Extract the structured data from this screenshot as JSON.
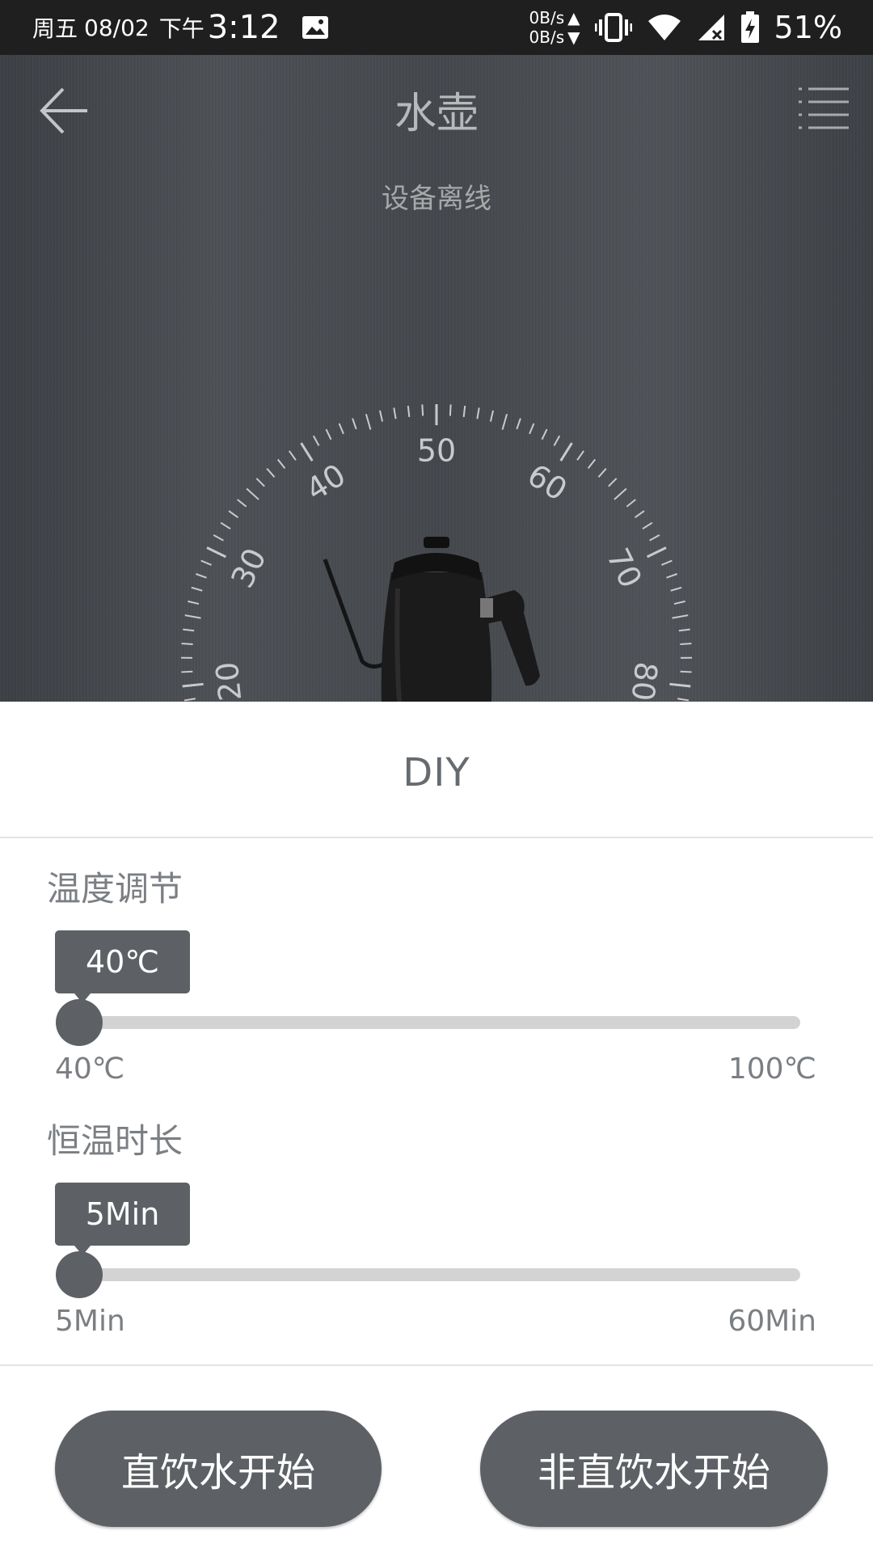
{
  "status_bar": {
    "weekday": "周五",
    "date": "08/02",
    "ampm": "下午",
    "time": "3:12",
    "net_up": "0B/s",
    "net_down": "0B/s",
    "battery": "51%"
  },
  "header": {
    "title": "水壶",
    "subtitle": "设备离线"
  },
  "dial": {
    "labels": [
      "20",
      "30",
      "40",
      "50",
      "60",
      "70",
      "80"
    ]
  },
  "diy": {
    "title": "DIY",
    "temperature": {
      "label": "温度调节",
      "value_label": "40℃",
      "min_label": "40℃",
      "max_label": "100℃",
      "value": 40,
      "min": 40,
      "max": 100
    },
    "duration": {
      "label": "恒温时长",
      "value_label": "5Min",
      "min_label": "5Min",
      "max_label": "60Min",
      "value": 5,
      "min": 5,
      "max": 60
    }
  },
  "actions": {
    "direct_drink": "直饮水开始",
    "non_direct_drink": "非直饮水开始"
  },
  "colors": {
    "accent": "#5d6165",
    "track": "#d3d3d3"
  }
}
